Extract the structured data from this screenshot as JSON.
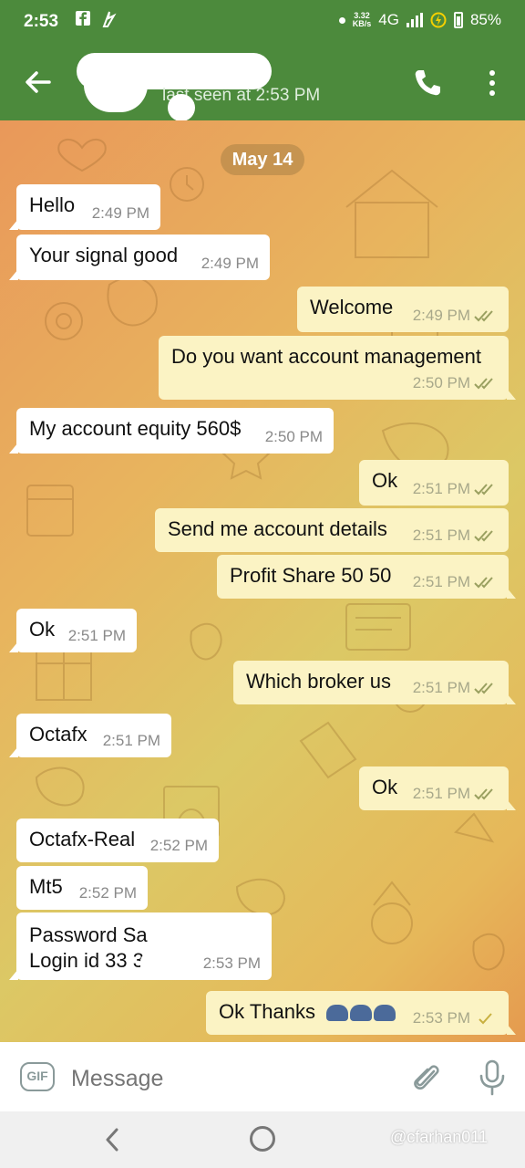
{
  "status_bar": {
    "time": "2:53",
    "left_icons": [
      "facebook-icon",
      "fire-icon"
    ],
    "net_speed_value": "3.32",
    "net_speed_unit": "KB/s",
    "network": "4G",
    "battery": "85%"
  },
  "header": {
    "contact_status": "last seen at 2:53 PM"
  },
  "chat": {
    "date": "May 14",
    "messages": [
      {
        "dir": "in",
        "text": "Hello",
        "time": "2:49 PM"
      },
      {
        "dir": "in",
        "text": "Your signal good",
        "time": "2:49 PM"
      },
      {
        "dir": "out",
        "text": "Welcome",
        "time": "2:49 PM"
      },
      {
        "dir": "out",
        "text": "Do you want account management",
        "time": "2:50 PM"
      },
      {
        "dir": "in",
        "text": "My account equity 560$",
        "time": "2:50 PM"
      },
      {
        "dir": "out",
        "text": "Ok",
        "time": "2:51 PM"
      },
      {
        "dir": "out",
        "text": "Send me account details",
        "time": "2:51 PM"
      },
      {
        "dir": "out",
        "text": "Profit Share 50 50",
        "time": "2:51 PM"
      },
      {
        "dir": "in",
        "text": "Ok",
        "time": "2:51 PM"
      },
      {
        "dir": "out",
        "text": "Which broker us",
        "time": "2:51 PM"
      },
      {
        "dir": "in",
        "text": "Octafx",
        "time": "2:51 PM"
      },
      {
        "dir": "out",
        "text": "Ok",
        "time": "2:51 PM"
      },
      {
        "dir": "in",
        "text": "Octafx-Real",
        "time": "2:52 PM"
      },
      {
        "dir": "in",
        "text": "Mt5",
        "time": "2:52 PM"
      },
      {
        "dir": "in",
        "text_line1": "Password Sa",
        "text_line2": "Login id 33      33",
        "time": "2:53 PM"
      },
      {
        "dir": "out",
        "text": "Ok Thanks",
        "time": "2:53 PM"
      }
    ]
  },
  "input": {
    "gif_label": "GIF",
    "placeholder": "Message"
  },
  "watermark": "@cfarhan011",
  "colors": {
    "header": "#4c8a3c",
    "incoming_bubble": "#ffffff",
    "outgoing_bubble": "#fbf3c4",
    "tick": "#9aa060"
  }
}
